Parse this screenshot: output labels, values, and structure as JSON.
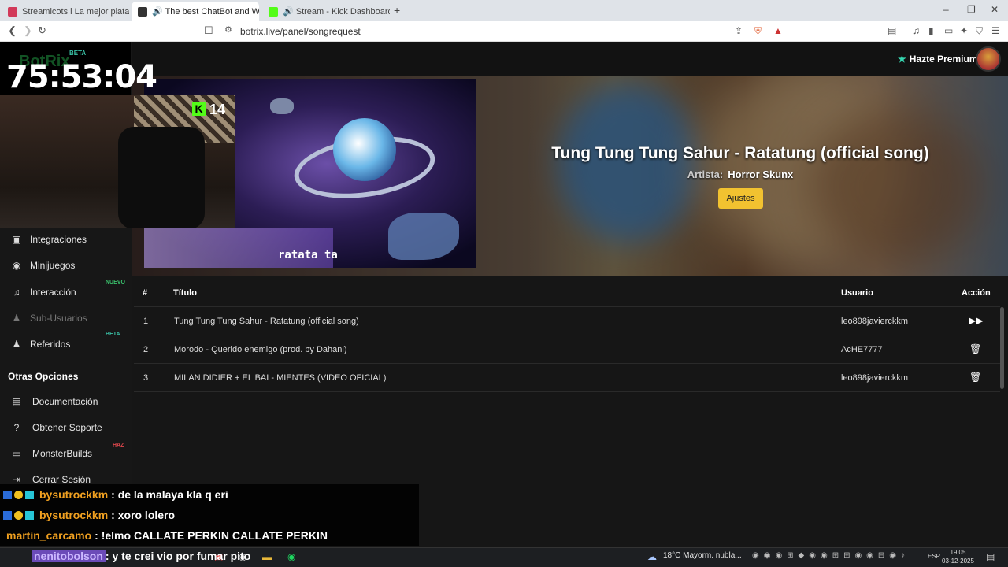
{
  "browser": {
    "tabs": [
      {
        "title": "Streamlcots l La mejor plataforma p..."
      },
      {
        "title": "🔊 The best ChatBot and Widget"
      },
      {
        "title": "🔊 Stream - Kick Dashboard"
      }
    ],
    "new_tab_glyph": "+",
    "url": "botrix.live/panel/songrequest",
    "window_controls": [
      "–",
      "❐",
      "✕"
    ]
  },
  "header": {
    "premium_label": "Hazte Premium"
  },
  "sidebar": {
    "items": [
      {
        "label": "Integraciones",
        "icon": "plug-icon",
        "glyph": "▣",
        "badge": ""
      },
      {
        "label": "Minijuegos",
        "icon": "gamepad-icon",
        "glyph": "◉",
        "badge": ""
      },
      {
        "label": "Interacción",
        "icon": "music-icon",
        "glyph": "♫",
        "badge": "NUEVO"
      },
      {
        "label": "Sub-Usuarios",
        "icon": "users-icon",
        "glyph": "♟",
        "badge": ""
      },
      {
        "label": "Referidos",
        "icon": "user-group-icon",
        "glyph": "♟",
        "badge": "BETA"
      }
    ],
    "section_title": "Otras Opciones",
    "other_items": [
      {
        "label": "Documentación",
        "icon": "book-icon",
        "glyph": "▤",
        "badge": ""
      },
      {
        "label": "Obtener Soporte",
        "icon": "question-icon",
        "glyph": "?",
        "badge": ""
      },
      {
        "label": "MonsterBuilds",
        "icon": "monitor-icon",
        "glyph": "▭",
        "badge": "HAZ"
      },
      {
        "label": "Cerrar Sesión",
        "icon": "logout-icon",
        "glyph": "⇥",
        "badge": ""
      }
    ],
    "badge_colors": {
      "NUEVO": "#3ac26c",
      "BETA": "#3ac2a7",
      "HAZ": "#e0474c"
    }
  },
  "now_playing": {
    "title": "Tung Tung Tung Sahur - Ratatung (official song)",
    "artist_label": "Artista:",
    "artist": "Horror Skunx",
    "settings_button": "Ajustes",
    "thumbnail_caption": "ratata ta"
  },
  "queue": {
    "columns": [
      "#",
      "Título",
      "Usuario",
      "Acción"
    ],
    "rows": [
      {
        "n": "1",
        "title": "Tung Tung Tung Sahur - Ratatung (official song)",
        "user": "leo898javierckkm",
        "action": "▶▶",
        "action_icon": "skip-forward-icon"
      },
      {
        "n": "2",
        "title": "Morodo - Querido enemigo (prod. by Dahani)",
        "user": "AcHE7777",
        "action": "🗑",
        "action_icon": "trash-icon"
      },
      {
        "n": "3",
        "title": "MILAN DIDIER + EL BAI - MIENTES (VIDEO OFICIAL)",
        "user": "leo898javierckkm",
        "action": "🗑",
        "action_icon": "trash-icon"
      }
    ]
  },
  "overlay": {
    "logo_text": "BotRix",
    "logo_badge": "BETA",
    "timer": "75:53:04",
    "kick_viewers": "14",
    "kick_badge": "K",
    "chat": [
      {
        "user": "bysutrockkm",
        "message": ": de la malaya kla q eri",
        "user_color": "#f0a020",
        "badges": true
      },
      {
        "user": "bysutrockkm",
        "message": ": xoro lolero",
        "user_color": "#f0a020",
        "badges": true
      },
      {
        "user": "martin_carcamo",
        "message": ": !elmo CALLATE PERKIN CALLATE PERKIN",
        "user_color": "#f0a020",
        "badges": false
      },
      {
        "user": "nenitobolson",
        "message": ": y te crei vio por fumar pito",
        "user_color": "#9b6bff",
        "badges": false
      }
    ]
  },
  "taskbar": {
    "weather": "18°C  Mayorm. nubla...",
    "lang": "ESP",
    "time": "19:05",
    "date": "03-12-2025"
  }
}
